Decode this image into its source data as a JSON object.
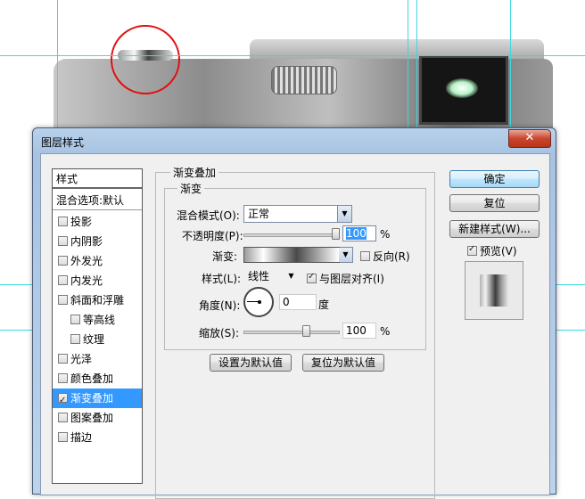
{
  "dialog": {
    "title": "图层样式",
    "close_symbol": "✕"
  },
  "styles": {
    "header": "样式",
    "blend_default": "混合选项:默认",
    "items": [
      {
        "label": "投影",
        "checked": false,
        "selected": false,
        "indent": false
      },
      {
        "label": "内阴影",
        "checked": false,
        "selected": false,
        "indent": false
      },
      {
        "label": "外发光",
        "checked": false,
        "selected": false,
        "indent": false
      },
      {
        "label": "内发光",
        "checked": false,
        "selected": false,
        "indent": false
      },
      {
        "label": "斜面和浮雕",
        "checked": false,
        "selected": false,
        "indent": false
      },
      {
        "label": "等高线",
        "checked": false,
        "selected": false,
        "indent": true
      },
      {
        "label": "纹理",
        "checked": false,
        "selected": false,
        "indent": true
      },
      {
        "label": "光泽",
        "checked": false,
        "selected": false,
        "indent": false
      },
      {
        "label": "颜色叠加",
        "checked": false,
        "selected": false,
        "indent": false
      },
      {
        "label": "渐变叠加",
        "checked": true,
        "selected": true,
        "indent": false
      },
      {
        "label": "图案叠加",
        "checked": false,
        "selected": false,
        "indent": false
      },
      {
        "label": "描边",
        "checked": false,
        "selected": false,
        "indent": false
      }
    ]
  },
  "gradient_overlay": {
    "section_title": "渐变叠加",
    "subsection_title": "渐变",
    "blend_mode_label": "混合模式(O):",
    "blend_mode_value": "正常",
    "opacity_label": "不透明度(P):",
    "opacity_value": "100",
    "opacity_fraction": 1.0,
    "percent": "%",
    "gradient_label": "渐变:",
    "reverse_label": "反向(R)",
    "reverse_checked": false,
    "style_label": "样式(L):",
    "style_value": "线性",
    "align_label": "与图层对齐(I)",
    "align_checked": true,
    "angle_label": "角度(N):",
    "angle_value": "0",
    "angle_unit": "度",
    "scale_label": "缩放(S):",
    "scale_value": "100",
    "scale_fraction": 0.67,
    "make_default": "设置为默认值",
    "reset_default": "复位为默认值"
  },
  "buttons": {
    "ok": "确定",
    "reset": "复位",
    "new_style": "新建样式(W)...",
    "preview_label": "预览(V)",
    "preview_checked": true
  },
  "colors": {
    "selection": "#3399ff",
    "guide": "#3fd7e0",
    "annotation_circle": "#e01010"
  },
  "icons": {
    "close": "close-icon",
    "dropdown": "chevron-down-icon",
    "checkbox": "checkbox-icon"
  }
}
